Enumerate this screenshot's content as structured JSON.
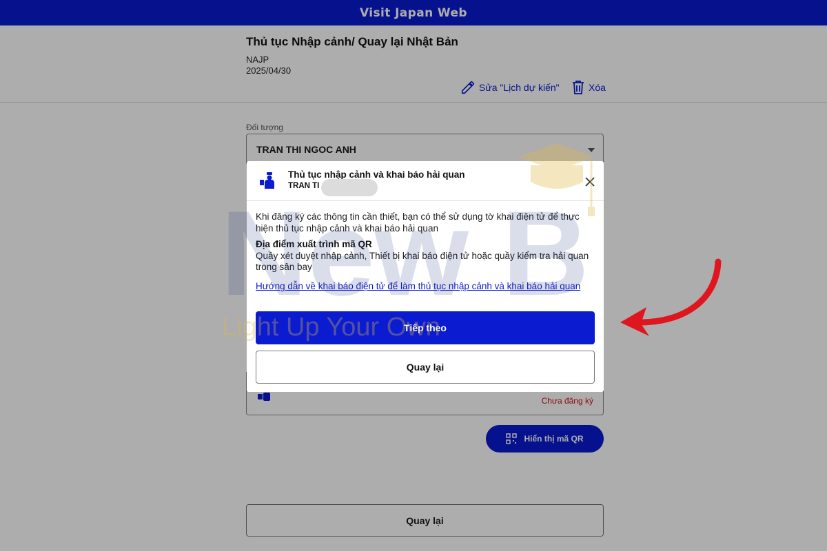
{
  "topbar": {
    "title": "Visit Japan Web"
  },
  "header": {
    "title": "Thủ tục Nhập cảnh/ Quay lại Nhật Bản",
    "code": "NAJP",
    "date": "2025/04/30",
    "edit_label": "Sửa \"Lịch dự kiến\"",
    "delete_label": "Xóa"
  },
  "target": {
    "label": "Đối tượng",
    "selected": "TRAN THI NGOC ANH"
  },
  "card": {
    "status": "Chưa đăng ký"
  },
  "qr_button": {
    "label": "Hiển thị mã QR"
  },
  "footer": {
    "back_label": "Quay lại"
  },
  "modal": {
    "title": "Thủ tục nhập cảnh và khai báo hải quan",
    "subtitle": "TRAN TI",
    "description": "Khi đăng ký các thông tin cần thiết, bạn có thể sử dụng tờ khai điện tử để thực hiện thủ tục nhập cảnh và khai báo hải quan",
    "location_heading": "Địa điểm xuất trình mã QR",
    "location_text": "Quầy xét duyệt nhập cảnh, Thiết bị khai báo điện tử hoặc quầy kiểm tra hải quan trong sân bay",
    "link": "Hướng dẫn về khai báo điện tử để làm thủ tục nhập cảnh và khai báo hải quan",
    "next_label": "Tiếp theo",
    "back_label": "Quay lại"
  },
  "watermark": {
    "brand": "New B",
    "tagline": "Light Up Your Own"
  },
  "colors": {
    "brand_blue": "#0a1bd0",
    "status_red": "#d01010",
    "arrow_red": "#e0161e"
  },
  "icons": [
    "edit-icon",
    "trash-icon",
    "officer-icon",
    "close-icon",
    "qr-icon",
    "graduation-cap-icon",
    "arrow-icon"
  ]
}
